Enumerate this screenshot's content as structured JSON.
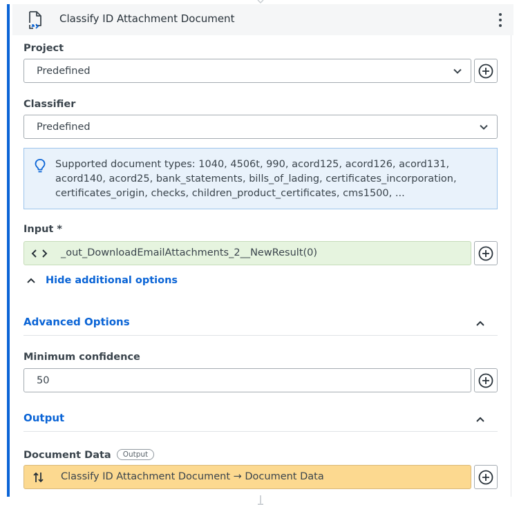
{
  "header": {
    "title": "Classify ID Attachment Document",
    "icon": "document-classify-icon",
    "menu_icon": "kebab-menu-icon"
  },
  "project": {
    "label": "Project",
    "value": "Predefined"
  },
  "classifier": {
    "label": "Classifier",
    "value": "Predefined"
  },
  "info": {
    "icon": "lightbulb-icon",
    "text": "Supported document types: 1040, 4506t, 990, acord125, acord126, acord131, acord140, acord25, bank_statements, bills_of_lading, certificates_incorporation, certificates_origin, checks, children_product_certificates, cms1500, ..."
  },
  "input": {
    "label": "Input *",
    "value": "_out_DownloadEmailAttachments_2__NewResult(0)",
    "icon": "expression-brackets-icon"
  },
  "toggle": {
    "label": "Hide additional options"
  },
  "advanced": {
    "title": "Advanced Options"
  },
  "min_confidence": {
    "label": "Minimum confidence",
    "value": "50"
  },
  "output_section": {
    "title": "Output"
  },
  "document_data": {
    "label": "Document Data",
    "badge": "Output",
    "value": "Classify ID Attachment Document → Document Data",
    "icon": "sort-arrows-icon"
  },
  "colors": {
    "accent": "#0a64d6",
    "input_bg": "#e6f4df",
    "output_bg": "#fcd990",
    "info_bg": "#e9f2fb"
  }
}
